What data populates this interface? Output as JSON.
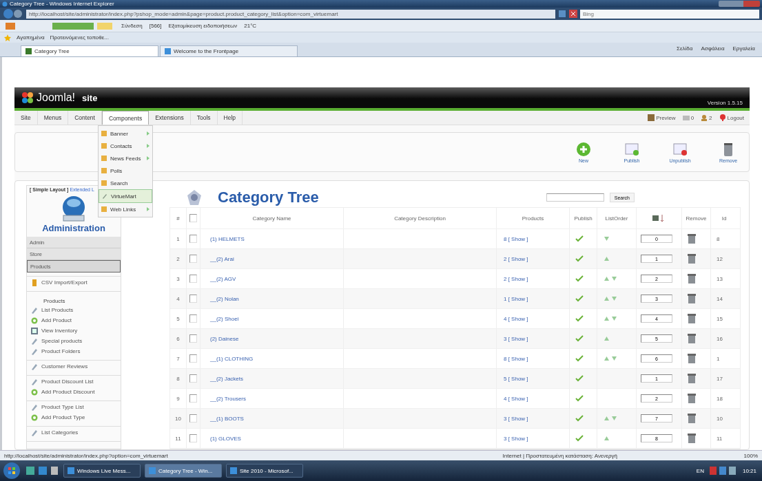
{
  "browser": {
    "title": "Category Tree - Windows Internet Explorer",
    "address": "http://localhost/site/administrator/index.php?pshop_mode=admin&page=product.product_category_list&option=com_virtuemart",
    "search_placeholder": "Bing",
    "toolbar_items": [
      "Σύνδεση",
      "[566]",
      "Εξατομίκευση ειδοποιήσεων",
      "21°C"
    ],
    "favorites_label": "Αγαπημένα",
    "suggested_sites": "Προτεινόμενες τοποθε...",
    "tabs": [
      {
        "label": "Category Tree",
        "selected": true
      },
      {
        "label": "Welcome to the Frontpage",
        "selected": false
      }
    ],
    "commands": [
      "Σελίδα",
      "Ασφάλεια",
      "Εργαλεία"
    ]
  },
  "joomla": {
    "logo": "Joomla!",
    "site": "site",
    "version": "Version 1.5.15",
    "menu": [
      {
        "label": "Site",
        "selected": false
      },
      {
        "label": "Menus",
        "selected": false
      },
      {
        "label": "Content",
        "selected": false
      },
      {
        "label": "Components",
        "selected": true
      },
      {
        "label": "Extensions",
        "selected": false
      },
      {
        "label": "Tools",
        "selected": false
      },
      {
        "label": "Help",
        "selected": false
      }
    ],
    "submenu": [
      {
        "label": "Banner",
        "selected": false,
        "has_children": true
      },
      {
        "label": "Contacts",
        "selected": false,
        "has_children": true
      },
      {
        "label": "News Feeds",
        "selected": false,
        "has_children": true
      },
      {
        "label": "Polls",
        "selected": false,
        "has_children": false
      },
      {
        "label": "Search",
        "selected": false,
        "has_children": false
      },
      {
        "label": "VirtueMart",
        "selected": true,
        "has_children": false
      },
      {
        "label": "Web Links",
        "selected": false,
        "has_children": true
      }
    ],
    "header_links": [
      {
        "kind": "preview",
        "label": "Preview"
      },
      {
        "kind": "messages",
        "label": "0"
      },
      {
        "kind": "users",
        "label": "2"
      },
      {
        "kind": "logout",
        "label": "Logout"
      }
    ],
    "toolbar": [
      {
        "kind": "new",
        "label": "New"
      },
      {
        "kind": "publish",
        "label": "Publish"
      },
      {
        "kind": "unpublish",
        "label": "Unpublish"
      },
      {
        "kind": "remove",
        "label": "Remove"
      }
    ]
  },
  "sidebar": {
    "layout_links": [
      {
        "label": "[ Simple Layout ]",
        "selected": true
      },
      {
        "label": "Extended L",
        "selected": false
      }
    ],
    "title": "Administration",
    "groups": [
      {
        "items": [
          {
            "kind": "section",
            "label": "Admin",
            "selected": false
          },
          {
            "kind": "section",
            "label": "Store",
            "selected": false
          },
          {
            "kind": "section",
            "label": "Products",
            "selected": true
          }
        ]
      },
      {
        "items": [
          {
            "kind": "import",
            "label": "CSV Import/Export"
          }
        ]
      },
      {
        "items": [
          {
            "kind": "heading",
            "label": "Products"
          },
          {
            "kind": "list",
            "label": "List Products"
          },
          {
            "kind": "add",
            "label": "Add Product"
          },
          {
            "kind": "inventory",
            "label": "View Inventory"
          },
          {
            "kind": "list",
            "label": "Special products"
          },
          {
            "kind": "list",
            "label": "Product Folders"
          }
        ]
      },
      {
        "items": [
          {
            "kind": "list",
            "label": "Customer Reviews"
          }
        ]
      },
      {
        "items": [
          {
            "kind": "list",
            "label": "Product Discount List"
          },
          {
            "kind": "add",
            "label": "Add Product Discount"
          }
        ]
      },
      {
        "items": [
          {
            "kind": "list",
            "label": "Product Type List"
          },
          {
            "kind": "add",
            "label": "Add Product Type"
          }
        ]
      },
      {
        "items": [
          {
            "kind": "list",
            "label": "List Categories"
          }
        ]
      }
    ]
  },
  "content": {
    "title": "Category Tree",
    "search_button": "Search",
    "select_all_checked": false,
    "columns": [
      "#",
      "Category Name",
      "Category Description",
      "Products",
      "Publish",
      "ListOrder",
      "Remove",
      "Id"
    ],
    "rows": [
      {
        "number": "1",
        "checked": false,
        "name": "(1) HELMETS",
        "products": "8 [ Show ]",
        "published": true,
        "order_up": false,
        "order_down": true,
        "order": "0",
        "id": "8"
      },
      {
        "number": "2",
        "checked": false,
        "name": "__(2) Arai",
        "products": "2 [ Show ]",
        "published": true,
        "order_up": true,
        "order_down": false,
        "order": "1",
        "id": "12"
      },
      {
        "number": "3",
        "checked": false,
        "name": "__(2) AGV",
        "products": "2 [ Show ]",
        "published": true,
        "order_up": true,
        "order_down": true,
        "order": "2",
        "id": "13"
      },
      {
        "number": "4",
        "checked": false,
        "name": "__(2) Nolan",
        "products": "1 [ Show ]",
        "published": true,
        "order_up": true,
        "order_down": true,
        "order": "3",
        "id": "14"
      },
      {
        "number": "5",
        "checked": false,
        "name": "__(2) Shoei",
        "products": "4 [ Show ]",
        "published": true,
        "order_up": true,
        "order_down": true,
        "order": "4",
        "id": "15"
      },
      {
        "number": "6",
        "checked": false,
        "name": "(2) Dainese",
        "products": "3 [ Show ]",
        "published": true,
        "order_up": true,
        "order_down": false,
        "order": "5",
        "id": "16"
      },
      {
        "number": "7",
        "checked": false,
        "name": "__(1) CLOTHING",
        "products": "8 [ Show ]",
        "published": true,
        "order_up": true,
        "order_down": true,
        "order": "6",
        "id": "1"
      },
      {
        "number": "8",
        "checked": false,
        "name": "__(2) Jackets",
        "products": "5 [ Show ]",
        "published": true,
        "order_up": false,
        "order_down": false,
        "order": "1",
        "id": "17"
      },
      {
        "number": "9",
        "checked": false,
        "name": "__(2) Trousers",
        "products": "4 [ Show ]",
        "published": true,
        "order_up": false,
        "order_down": false,
        "order": "2",
        "id": "18"
      },
      {
        "number": "10",
        "checked": false,
        "name": "__(1) BOOTS",
        "products": "3 [ Show ]",
        "published": true,
        "order_up": true,
        "order_down": true,
        "order": "7",
        "id": "10"
      },
      {
        "number": "11",
        "checked": false,
        "name": "(1) GLOVES",
        "products": "3 [ Show ]",
        "published": true,
        "order_up": true,
        "order_down": false,
        "order": "8",
        "id": "11"
      }
    ]
  },
  "status_bar": {
    "url": "http://localhost/site/administrator/index.php?option=com_virtuemart",
    "zone": "Internet | Προστατευμένη κατάσταση: Ανενεργή",
    "zoom": "100%"
  },
  "taskbar": {
    "items": [
      {
        "label": "Windows Live Mess...",
        "selected": false
      },
      {
        "label": "Category Tree - Win...",
        "selected": true
      },
      {
        "label": "Site 2010 - Microsof...",
        "selected": false
      }
    ],
    "language": "EN",
    "clock": "10:21"
  }
}
